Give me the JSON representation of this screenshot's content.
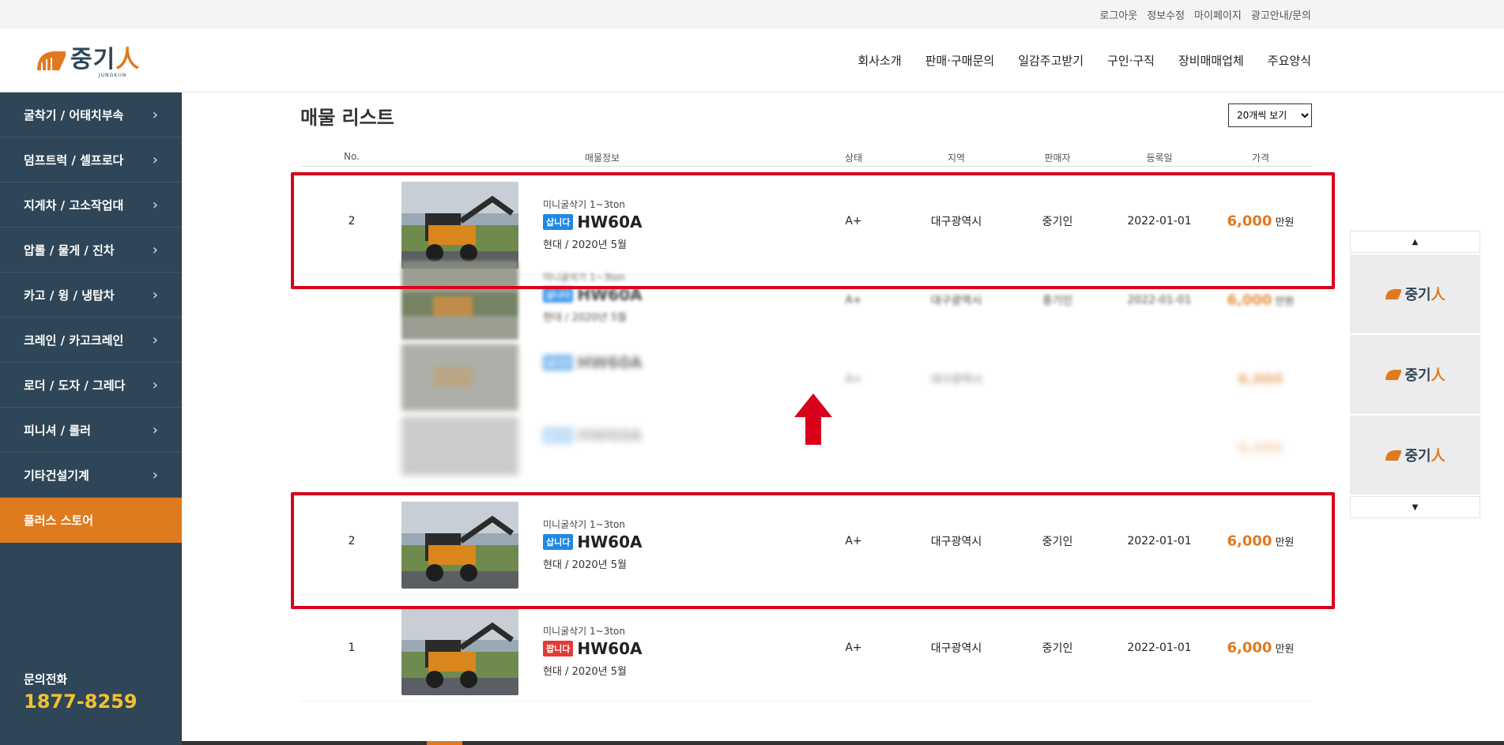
{
  "util_links": [
    "로그아웃",
    "정보수정",
    "마이페이지",
    "광고안내/문의"
  ],
  "logo": {
    "text_main": "중기",
    "text_accent": "人",
    "sub": "JUNGKIIN"
  },
  "gnb": [
    "회사소개",
    "판매·구매문의",
    "일감주고받기",
    "구인·구직",
    "장비매매업체",
    "주요양식"
  ],
  "sidebar": {
    "items": [
      {
        "label": "굴착기 / 어태치부속",
        "chev": "›"
      },
      {
        "label": "덤프트럭 / 셀프로다",
        "chev": "›"
      },
      {
        "label": "지게차 / 고소작업대",
        "chev": "›"
      },
      {
        "label": "압롤 / 물게 / 진차",
        "chev": "›"
      },
      {
        "label": "카고 / 윙 / 냉탑차",
        "chev": "›"
      },
      {
        "label": "크레인 / 카고크레인",
        "chev": "›"
      },
      {
        "label": "로더 / 도자 / 그레다",
        "chev": "›"
      },
      {
        "label": "피니셔 / 롤러",
        "chev": "›"
      },
      {
        "label": "기타건설기계",
        "chev": "›"
      }
    ],
    "active_item": "플러스 스토어",
    "phone_label": "문의전화",
    "phone_number": "1877-8259"
  },
  "main": {
    "title": "매물 리스트",
    "view_option": "20개씩 보기",
    "columns": [
      "No.",
      "매물정보",
      "상태",
      "지역",
      "판매자",
      "등록일",
      "가격"
    ],
    "rows": [
      {
        "no": "2",
        "category": "미니굴삭기 1~3ton",
        "badge": "삽니다",
        "badge_color": "#1e88e5",
        "model": "HW60A",
        "maker": "현대 / 2020년 5월",
        "status": "A+",
        "region": "대구광역시",
        "seller": "중기인",
        "date": "2022-01-01",
        "price": "6,000",
        "unit": "만원"
      },
      {
        "no": "2",
        "category": "미니굴삭기 1~3ton",
        "badge": "삽니다",
        "badge_color": "#1e88e5",
        "model": "HW60A",
        "maker": "현대 / 2020년 5월",
        "status": "A+",
        "region": "대구광역시",
        "seller": "중기인",
        "date": "2022-01-01",
        "price": "6,000",
        "unit": "만원"
      },
      {
        "no": "1",
        "category": "미니굴삭기 1~3ton",
        "badge": "팝니다",
        "badge_color": "#e53935",
        "model": "HW60A",
        "maker": "현대 / 2020년 5월",
        "status": "A+",
        "region": "대구광역시",
        "seller": "중기인",
        "date": "2022-01-01",
        "price": "6,000",
        "unit": "만원"
      }
    ]
  },
  "right_widget": {
    "up": "▲",
    "down": "▼",
    "slots": 3
  },
  "colors": {
    "sidebar": "#2e4657",
    "accent": "#e07a1f",
    "highlight": "#d9001b",
    "phone": "#f2c12e"
  }
}
